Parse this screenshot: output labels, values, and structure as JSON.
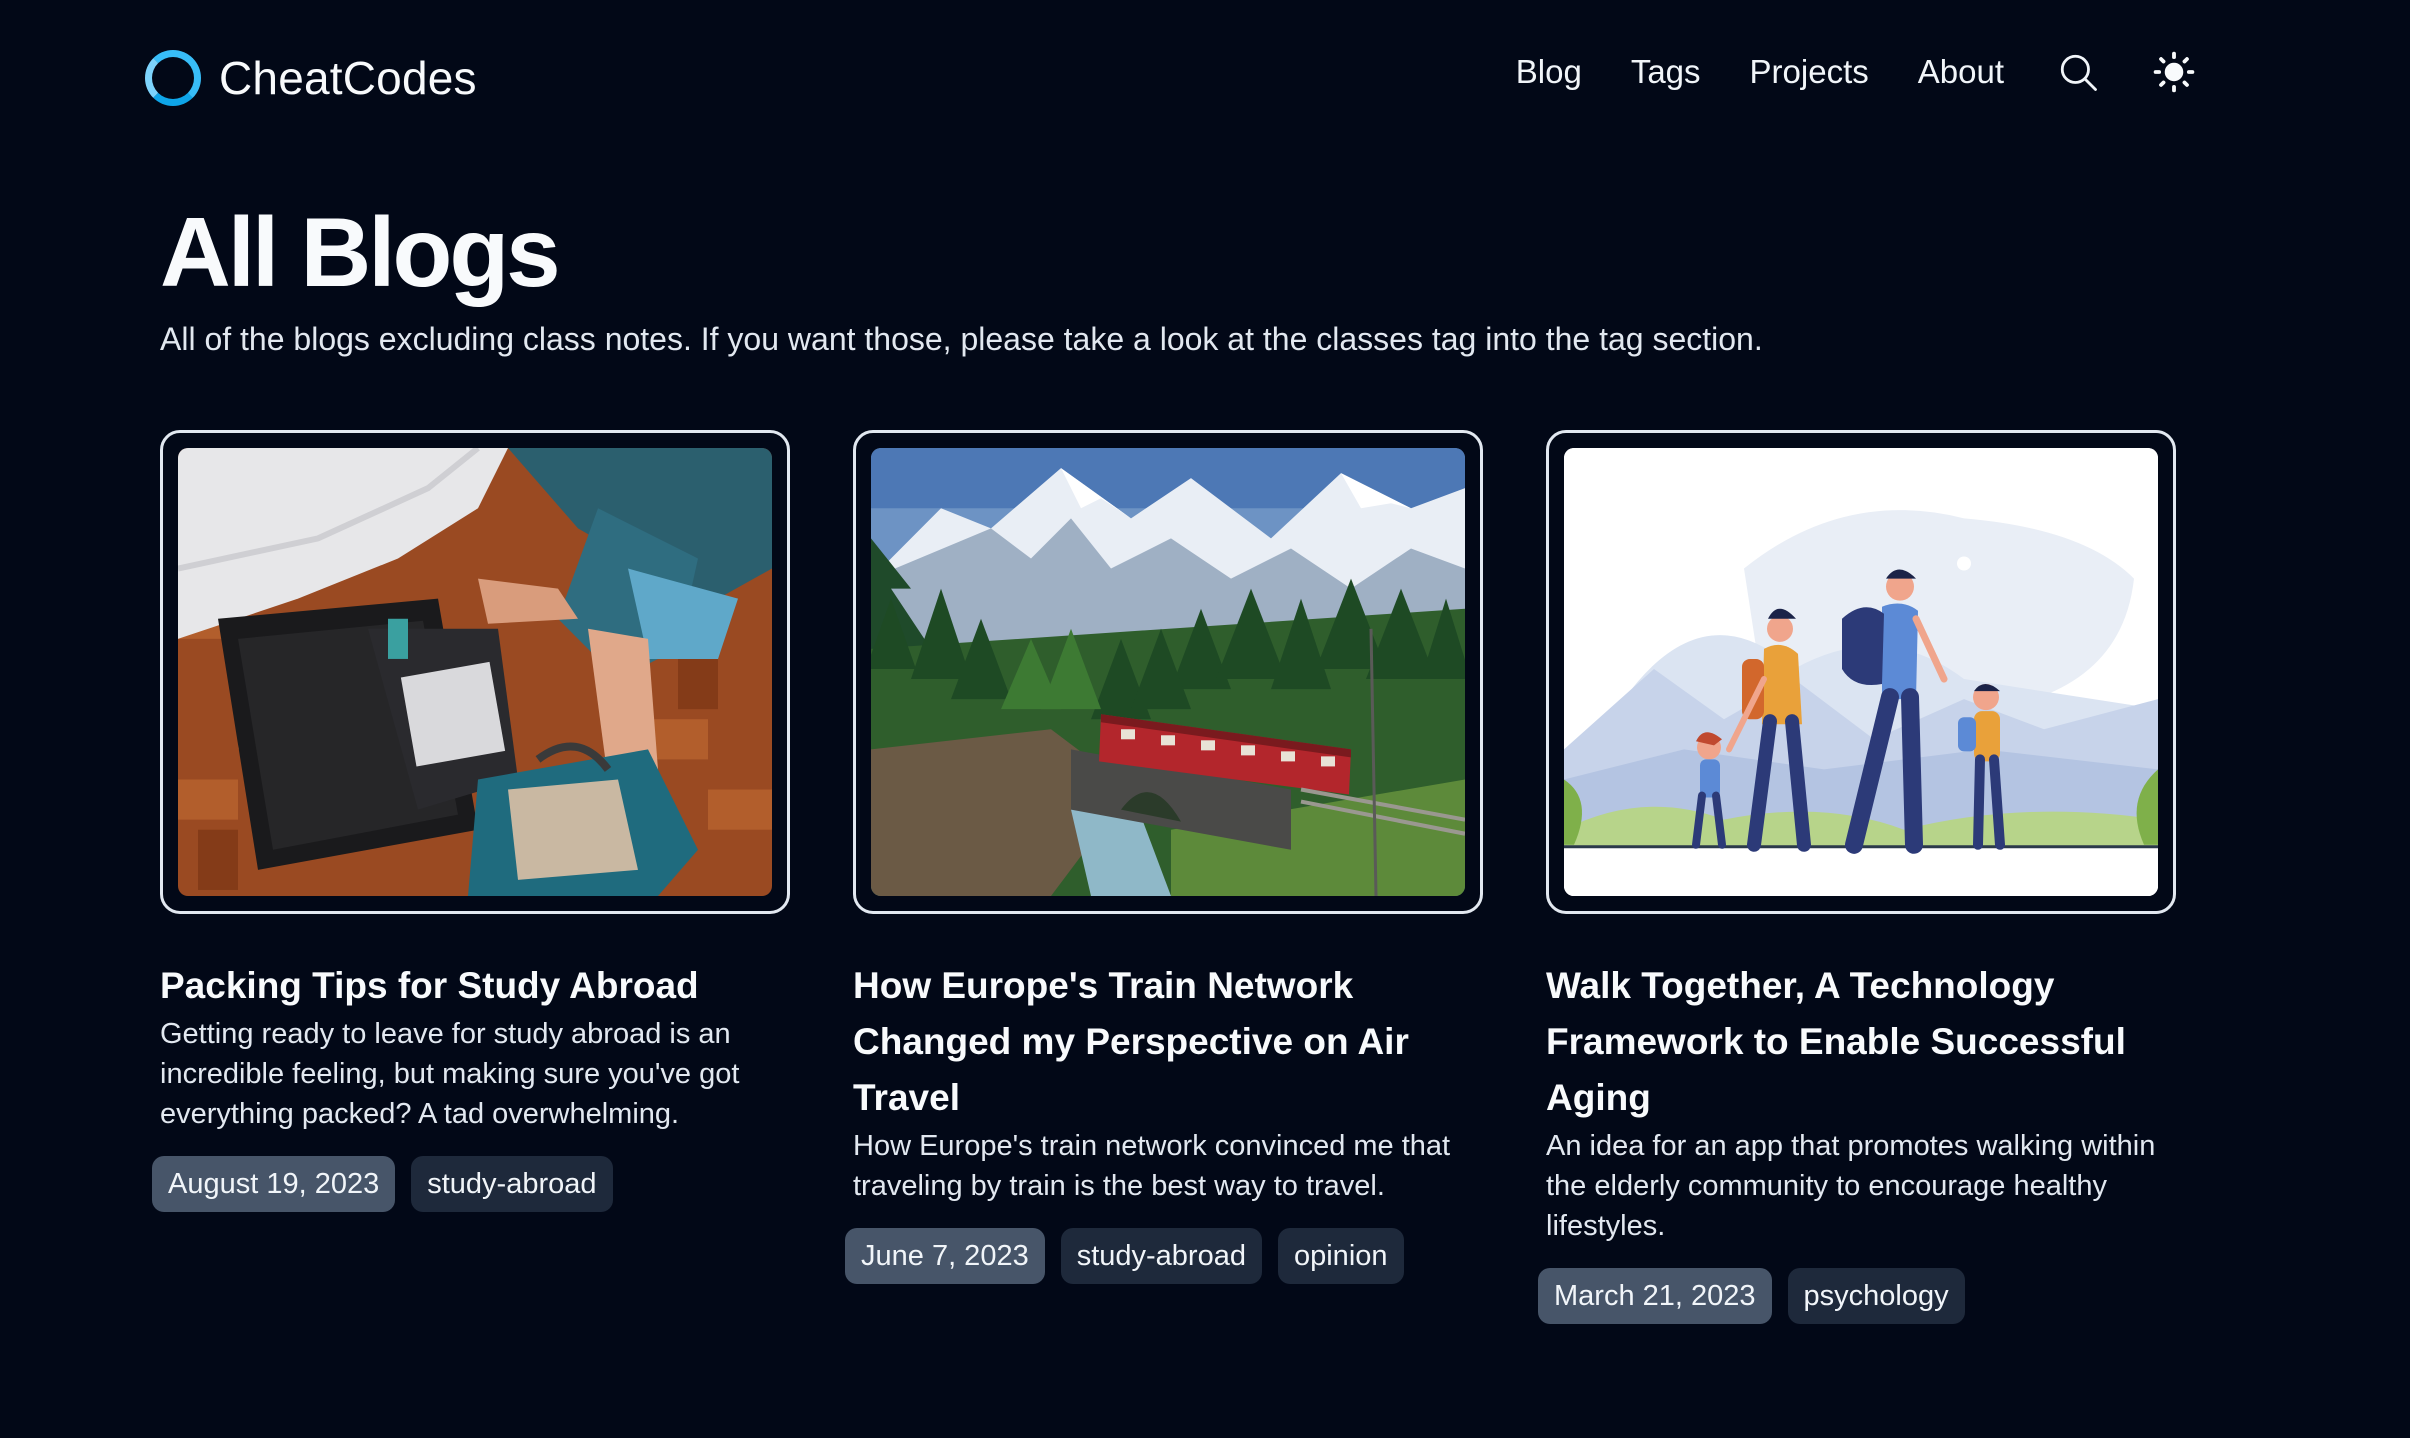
{
  "brand": {
    "name": "CheatCodes",
    "accent": "#38bdf8"
  },
  "nav": {
    "links": [
      "Blog",
      "Tags",
      "Projects",
      "About"
    ],
    "search_icon": "search-icon",
    "theme_icon": "sun-icon"
  },
  "page": {
    "title": "All Blogs",
    "description": "All of the blogs excluding class notes. If you want those, please take a look at the classes tag into the tag section."
  },
  "posts": [
    {
      "title": "Packing Tips for Study Abroad",
      "description": "Getting ready to leave for study abroad is an incredible feeling, but making sure you've got everything packed? A tad overwhelming.",
      "date": "August 19, 2023",
      "tags": [
        "study-abroad"
      ],
      "image": "suitcase-packing-photo"
    },
    {
      "title": "How Europe's Train Network Changed my Perspective on Air Travel",
      "description": "How Europe's train network convinced me that traveling by train is the best way to travel.",
      "date": "June 7, 2023",
      "tags": [
        "study-abroad",
        "opinion"
      ],
      "image": "mountain-train-photo"
    },
    {
      "title": "Walk Together, A Technology Framework to Enable Successful Aging",
      "description": "An idea for an app that promotes walking within the elderly community to encourage healthy lifestyles.",
      "date": "March 21, 2023",
      "tags": [
        "psychology"
      ],
      "image": "family-walking-illustration"
    }
  ],
  "colors": {
    "background": "#020817",
    "date_chip": "#475569",
    "tag_chip": "#1e293b"
  }
}
